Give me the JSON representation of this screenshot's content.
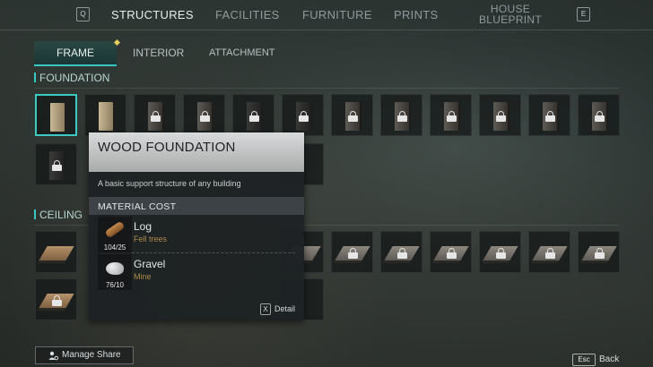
{
  "top_nav": {
    "left_key": "Q",
    "right_key": "E",
    "tabs": [
      {
        "label": "STRUCTURES",
        "active": true
      },
      {
        "label": "FACILITIES",
        "active": false
      },
      {
        "label": "FURNITURE",
        "active": false
      },
      {
        "label": "PRINTS",
        "active": false
      },
      {
        "label": "HOUSE BLUEPRINT",
        "active": false
      }
    ]
  },
  "sub_tabs": [
    {
      "label": "FRAME",
      "active": true
    },
    {
      "label": "INTERIOR",
      "active": false
    },
    {
      "label": "ATTACHMENT",
      "active": false
    }
  ],
  "sections": {
    "foundation": "FOUNDATION",
    "ceiling": "CEILING"
  },
  "tooltip": {
    "title": "WOOD FOUNDATION",
    "description": "A basic support structure of any building",
    "material_header": "MATERIAL COST",
    "materials": [
      {
        "name": "Log",
        "source": "Fell trees",
        "count": "104/25",
        "icon": "log-icon"
      },
      {
        "name": "Gravel",
        "source": "Mine",
        "count": "76/10",
        "icon": "gravel-icon"
      }
    ],
    "detail_key": "X",
    "detail_label": "Detail"
  },
  "footer": {
    "manage_share": "Manage Share",
    "esc_key": "Esc",
    "back_label": "Back"
  },
  "colors": {
    "accent": "#39c7c2",
    "material_source": "#b08a4a"
  }
}
